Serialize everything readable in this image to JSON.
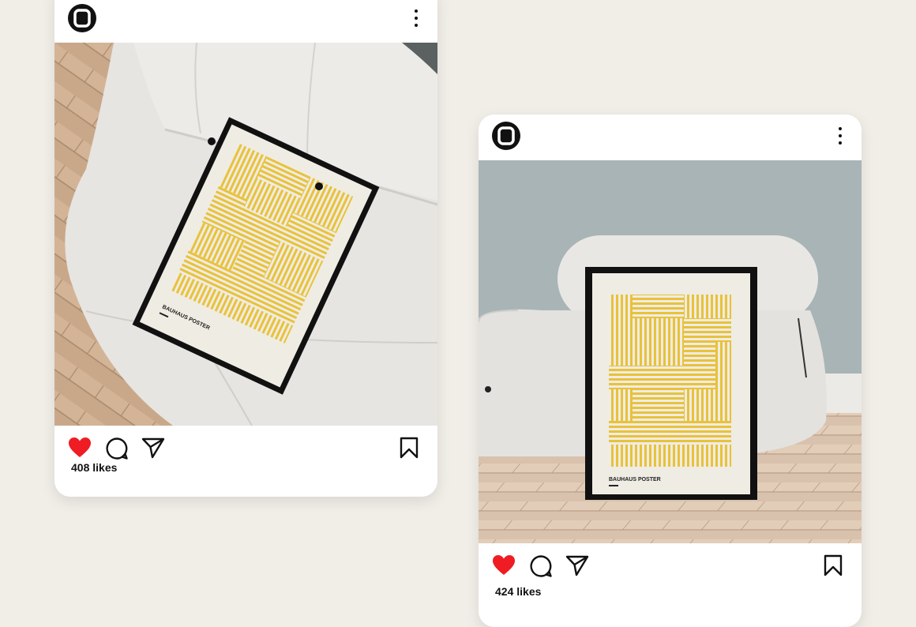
{
  "posts": [
    {
      "likes_text": "408 likes",
      "poster_title": "BAUHAUS POSTER",
      "liked": true,
      "icons": [
        "profile-logo-icon",
        "more-options-icon",
        "heart-icon",
        "comment-icon",
        "send-icon",
        "bookmark-icon"
      ]
    },
    {
      "likes_text": "424 likes",
      "poster_title": "BAUHAUS POSTER",
      "liked": true,
      "icons": [
        "profile-logo-icon",
        "more-options-icon",
        "heart-icon",
        "comment-icon",
        "send-icon",
        "bookmark-icon"
      ]
    }
  ],
  "colors": {
    "background": "#f1eee8",
    "card": "#ffffff",
    "heart": "#ef1c24",
    "poster_yellow": "#e8c23a",
    "frame": "#111111"
  }
}
